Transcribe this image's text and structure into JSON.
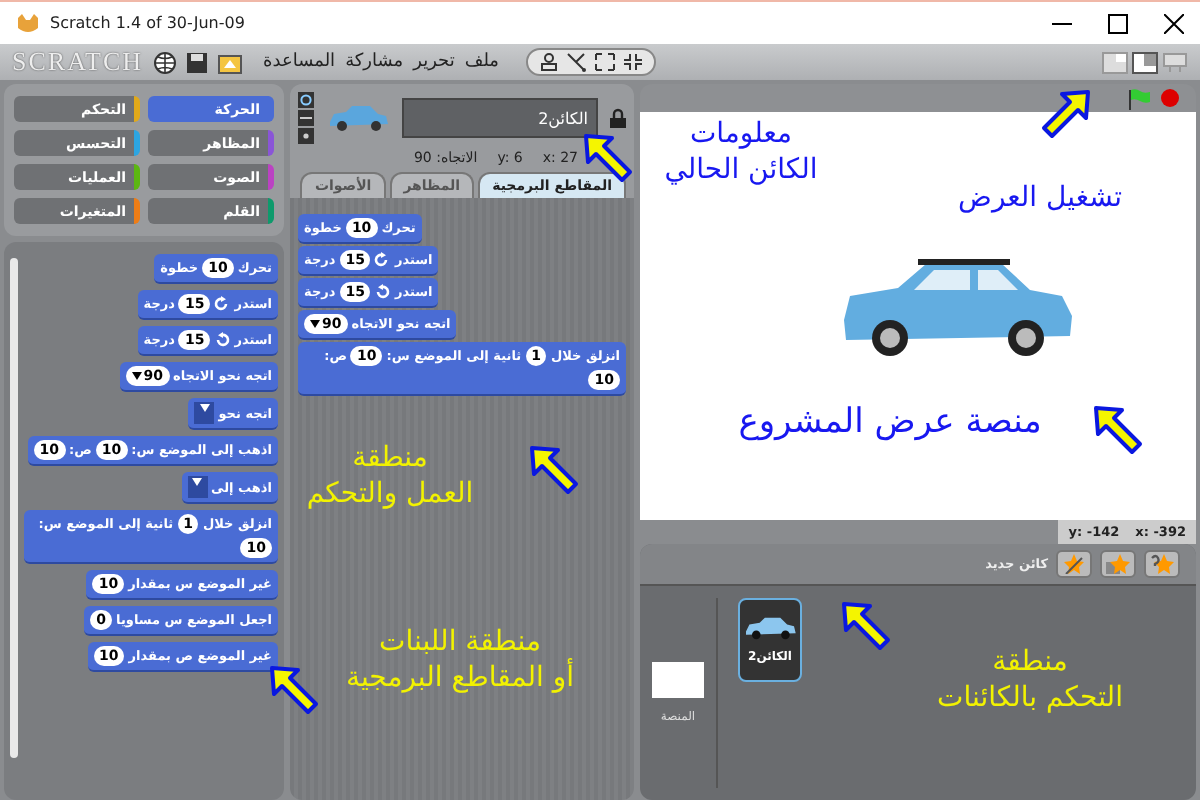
{
  "window": {
    "title": "Scratch 1.4 of 30-Jun-09"
  },
  "logo": "SCRATCH",
  "menu": [
    {
      "label": "ملف"
    },
    {
      "label": "تحرير"
    },
    {
      "label": "مشاركة"
    },
    {
      "label": "المساعدة"
    }
  ],
  "categories": [
    {
      "label": "الحركة",
      "color": "#4a6cd4",
      "selected": true
    },
    {
      "label": "التحكم",
      "color": "#e1a91a",
      "selected": false
    },
    {
      "label": "المظاهر",
      "color": "#8a55d7",
      "selected": false
    },
    {
      "label": "التحسس",
      "color": "#2ca5e2",
      "selected": false
    },
    {
      "label": "الصوت",
      "color": "#bb42c3",
      "selected": false
    },
    {
      "label": "العمليات",
      "color": "#5cb712",
      "selected": false
    },
    {
      "label": "القلم",
      "color": "#0e9a6c",
      "selected": false
    },
    {
      "label": "المتغيرات",
      "color": "#ee7d16",
      "selected": false
    }
  ],
  "palette": [
    {
      "parts": [
        {
          "kind": "text",
          "text": "تحرك"
        },
        {
          "kind": "number",
          "text": "10"
        },
        {
          "kind": "text",
          "text": "خطوة"
        }
      ]
    },
    {
      "parts": [
        {
          "kind": "text",
          "text": "استدر"
        },
        {
          "kind": "cw"
        },
        {
          "kind": "number",
          "text": "15"
        },
        {
          "kind": "text",
          "text": "درجة"
        }
      ]
    },
    {
      "parts": [
        {
          "kind": "text",
          "text": "استدر"
        },
        {
          "kind": "ccw"
        },
        {
          "kind": "number",
          "text": "15"
        },
        {
          "kind": "text",
          "text": "درجة"
        }
      ]
    },
    {
      "parts": [
        {
          "kind": "text",
          "text": "اتجه نحو الاتجاه"
        },
        {
          "kind": "dropdown",
          "text": "90"
        }
      ]
    },
    {
      "parts": [
        {
          "kind": "text",
          "text": "اتجه نحو"
        },
        {
          "kind": "menu"
        }
      ]
    },
    {
      "parts": [
        {
          "kind": "text",
          "text": "اذهب إلى الموضع س:"
        },
        {
          "kind": "number",
          "text": "10"
        },
        {
          "kind": "text",
          "text": "ص:"
        },
        {
          "kind": "number",
          "text": "10"
        }
      ]
    },
    {
      "parts": [
        {
          "kind": "text",
          "text": "اذهب إلى"
        },
        {
          "kind": "menu"
        }
      ]
    },
    {
      "parts": [
        {
          "kind": "text",
          "text": "انزلق خلال"
        },
        {
          "kind": "number",
          "text": "1"
        },
        {
          "kind": "text",
          "text": "ثانية إلى الموضع س:"
        },
        {
          "kind": "number",
          "text": "10"
        }
      ]
    },
    {
      "parts": [
        {
          "kind": "text",
          "text": "غير الموضع س بمقدار"
        },
        {
          "kind": "number",
          "text": "10"
        }
      ]
    },
    {
      "parts": [
        {
          "kind": "text",
          "text": "اجعل الموضع س مساويا"
        },
        {
          "kind": "number",
          "text": "0"
        }
      ]
    },
    {
      "parts": [
        {
          "kind": "text",
          "text": "غير الموضع ص بمقدار"
        },
        {
          "kind": "number",
          "text": "10"
        }
      ]
    }
  ],
  "sprite_info": {
    "name": "الكائن2",
    "locked": true,
    "x": {
      "label": "x:",
      "value": "27"
    },
    "y": {
      "label": "y:",
      "value": "6"
    },
    "direction": {
      "label": "الاتجاه:",
      "value": "90"
    }
  },
  "tabs": [
    {
      "label": "المقاطع البرمجية",
      "selected": true
    },
    {
      "label": "المظاهر",
      "selected": false
    },
    {
      "label": "الأصوات",
      "selected": false
    }
  ],
  "script": [
    {
      "parts": [
        {
          "kind": "text",
          "text": "تحرك"
        },
        {
          "kind": "number",
          "text": "10"
        },
        {
          "kind": "text",
          "text": "خطوة"
        }
      ]
    },
    {
      "parts": [
        {
          "kind": "text",
          "text": "استدر"
        },
        {
          "kind": "cw"
        },
        {
          "kind": "number",
          "text": "15"
        },
        {
          "kind": "text",
          "text": "درجة"
        }
      ]
    },
    {
      "parts": [
        {
          "kind": "text",
          "text": "استدر"
        },
        {
          "kind": "ccw"
        },
        {
          "kind": "number",
          "text": "15"
        },
        {
          "kind": "text",
          "text": "درجة"
        }
      ]
    },
    {
      "parts": [
        {
          "kind": "text",
          "text": "اتجه نحو الاتجاه"
        },
        {
          "kind": "dropdown",
          "text": "90"
        }
      ]
    },
    {
      "parts": [
        {
          "kind": "text",
          "text": "انزلق خلال"
        },
        {
          "kind": "number",
          "text": "1"
        },
        {
          "kind": "text",
          "text": "ثانية إلى الموضع س:"
        },
        {
          "kind": "number",
          "text": "10"
        },
        {
          "kind": "text",
          "text": "ص:"
        },
        {
          "kind": "number",
          "text": "10"
        }
      ]
    }
  ],
  "mouse_position": {
    "x": {
      "label": "x:",
      "value": "-392"
    },
    "y": {
      "label": "y:",
      "value": "-142"
    }
  },
  "new_sprite_label": "كائن جديد",
  "sprites": [
    {
      "name": "الكائن2",
      "selected": true
    }
  ],
  "stage_label": "المنصة",
  "annotations": [
    {
      "lines": [
        "معلومات",
        "الكائن الحالي"
      ]
    },
    {
      "lines": [
        "تشغيل العرض"
      ]
    },
    {
      "lines": [
        "منطقة",
        "العمل والتحكم"
      ]
    },
    {
      "lines": [
        "منصة عرض المشروع"
      ]
    },
    {
      "lines": [
        "منطقة اللبنات",
        "أو المقاطع البرمجية"
      ]
    },
    {
      "lines": [
        "منطقة",
        "التحكم بالكائنات"
      ]
    }
  ]
}
